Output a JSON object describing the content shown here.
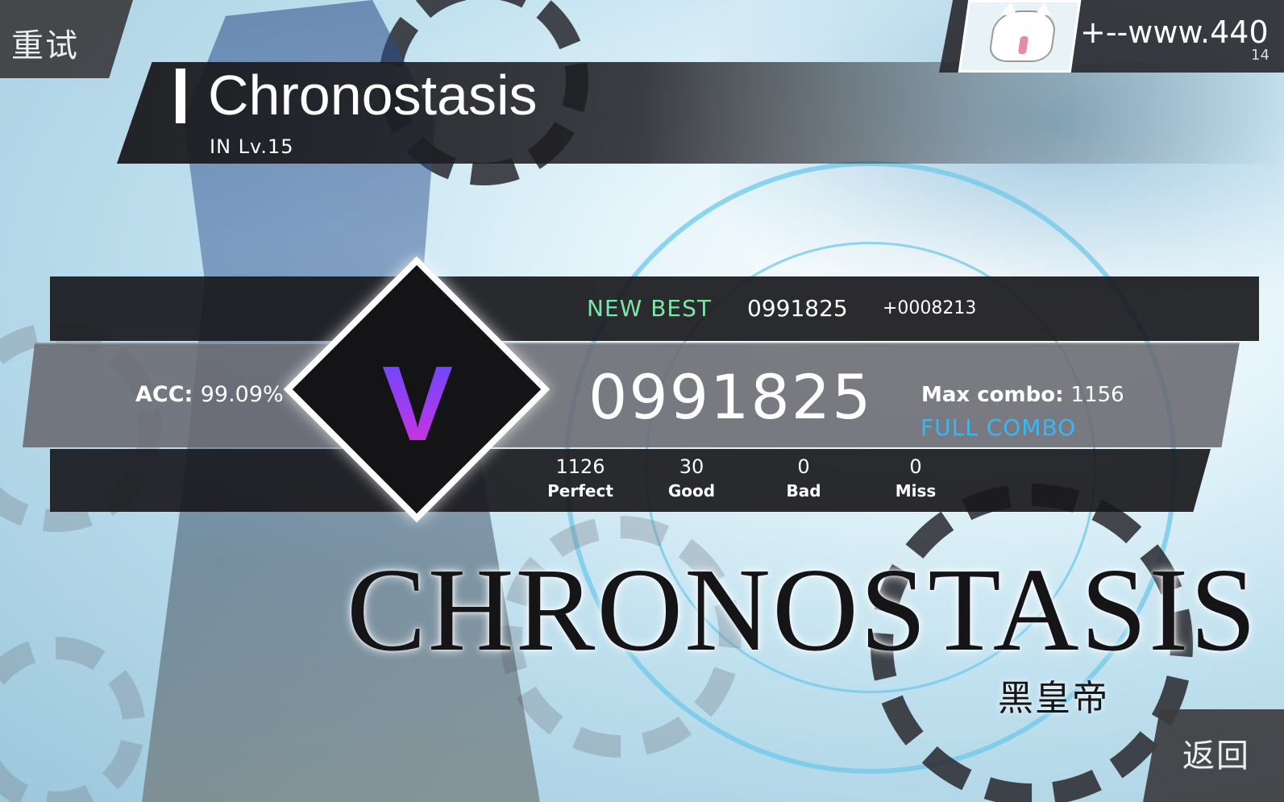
{
  "retry_label": "重试",
  "back_label": "返回",
  "song": {
    "title": "Chronostasis",
    "level": "IN  Lv.15",
    "logo_text": "CHRONOSTASIS",
    "artist": "黑皇帝"
  },
  "player": {
    "name": "+--www.440",
    "rks": "14",
    "avatar": "cat-avatar"
  },
  "result": {
    "new_best_label": "NEW BEST",
    "best_score": "0991825",
    "best_delta": "+0008213",
    "acc_label": "ACC:",
    "acc_value": "99.09%",
    "rank": "V",
    "score": "0991825",
    "max_combo_label": "Max combo:",
    "max_combo_value": "1156",
    "full_combo": "FULL COMBO",
    "judgements": [
      {
        "count": "1126",
        "label": "Perfect"
      },
      {
        "count": "30",
        "label": "Good"
      },
      {
        "count": "0",
        "label": "Bad"
      },
      {
        "count": "0",
        "label": "Miss"
      }
    ]
  },
  "colors": {
    "new_best": "#7fe6a8",
    "full_combo": "#3ab6f0",
    "rank_gradient_top": "#5a4dff",
    "rank_gradient_bottom": "#e22ed8"
  }
}
